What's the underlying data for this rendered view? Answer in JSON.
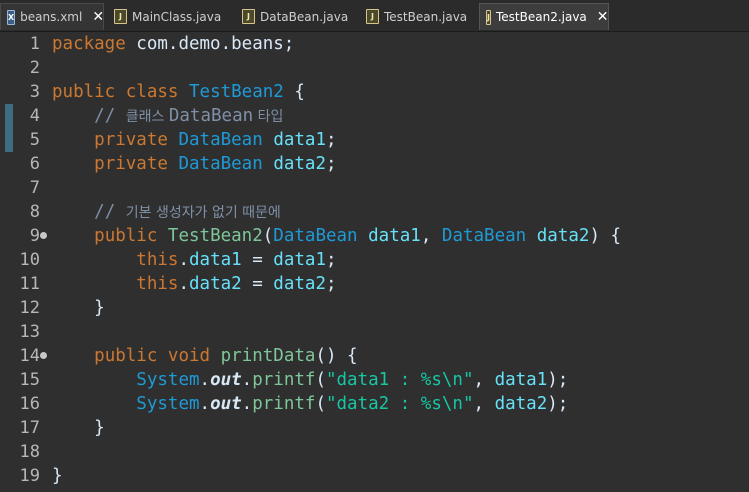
{
  "tabs": [
    {
      "label": "beans.xml",
      "icon": "xml-file-icon",
      "active": false,
      "closable": true
    },
    {
      "label": "MainClass.java",
      "icon": "java-file-icon",
      "active": false,
      "closable": false
    },
    {
      "label": "DataBean.java",
      "icon": "java-file-icon",
      "active": false,
      "closable": false
    },
    {
      "label": "TestBean.java",
      "icon": "java-file-icon",
      "active": false,
      "closable": false
    },
    {
      "label": "TestBean2.java",
      "icon": "java-file-icon",
      "active": true,
      "closable": true
    }
  ],
  "icons": {
    "xml": "X",
    "java": "J",
    "close": "✕",
    "fold": "⊖"
  },
  "lines": [
    {
      "n": "1",
      "tokens": [
        [
          "kw",
          "package"
        ],
        [
          "plain",
          " com.demo.beans;"
        ]
      ]
    },
    {
      "n": "2",
      "tokens": []
    },
    {
      "n": "3",
      "tokens": [
        [
          "kw",
          "public"
        ],
        [
          "plain",
          " "
        ],
        [
          "kw",
          "class"
        ],
        [
          "plain",
          " "
        ],
        [
          "cls",
          "TestBean2"
        ],
        [
          "plain",
          " {"
        ]
      ]
    },
    {
      "n": "4",
      "tokens": [
        [
          "plain",
          "    "
        ],
        [
          "cmt-mono",
          "// "
        ],
        [
          "cmt",
          "클래스 "
        ],
        [
          "cmt-mono",
          "DataBean"
        ],
        [
          "cmt",
          " 타입"
        ]
      ]
    },
    {
      "n": "5",
      "tokens": [
        [
          "plain",
          "    "
        ],
        [
          "kw",
          "private"
        ],
        [
          "plain",
          " "
        ],
        [
          "cls",
          "DataBean"
        ],
        [
          "plain",
          " "
        ],
        [
          "var",
          "data1"
        ],
        [
          "plain",
          ";"
        ]
      ]
    },
    {
      "n": "6",
      "tokens": [
        [
          "plain",
          "    "
        ],
        [
          "kw",
          "private"
        ],
        [
          "plain",
          " "
        ],
        [
          "cls",
          "DataBean"
        ],
        [
          "plain",
          " "
        ],
        [
          "var",
          "data2"
        ],
        [
          "plain",
          ";"
        ]
      ]
    },
    {
      "n": "7",
      "tokens": []
    },
    {
      "n": "8",
      "tokens": [
        [
          "plain",
          "    "
        ],
        [
          "cmt-mono",
          "// "
        ],
        [
          "cmt",
          "기본 생성자가 없기 때문에"
        ]
      ]
    },
    {
      "n": "9",
      "fold": true,
      "tokens": [
        [
          "plain",
          "    "
        ],
        [
          "kw",
          "public"
        ],
        [
          "plain",
          " "
        ],
        [
          "mth",
          "TestBean2"
        ],
        [
          "plain",
          "("
        ],
        [
          "cls",
          "DataBean"
        ],
        [
          "plain",
          " "
        ],
        [
          "var",
          "data1"
        ],
        [
          "plain",
          ", "
        ],
        [
          "cls",
          "DataBean"
        ],
        [
          "plain",
          " "
        ],
        [
          "var",
          "data2"
        ],
        [
          "plain",
          ") {"
        ]
      ]
    },
    {
      "n": "10",
      "tokens": [
        [
          "plain",
          "        "
        ],
        [
          "kw",
          "this"
        ],
        [
          "plain",
          "."
        ],
        [
          "var",
          "data1"
        ],
        [
          "plain",
          " = "
        ],
        [
          "var",
          "data1"
        ],
        [
          "plain",
          ";"
        ]
      ]
    },
    {
      "n": "11",
      "tokens": [
        [
          "plain",
          "        "
        ],
        [
          "kw",
          "this"
        ],
        [
          "plain",
          "."
        ],
        [
          "var",
          "data2"
        ],
        [
          "plain",
          " = "
        ],
        [
          "var",
          "data2"
        ],
        [
          "plain",
          ";"
        ]
      ]
    },
    {
      "n": "12",
      "tokens": [
        [
          "plain",
          "    }"
        ]
      ]
    },
    {
      "n": "13",
      "tokens": []
    },
    {
      "n": "14",
      "fold": true,
      "tokens": [
        [
          "plain",
          "    "
        ],
        [
          "kw",
          "public"
        ],
        [
          "plain",
          " "
        ],
        [
          "kw",
          "void"
        ],
        [
          "plain",
          " "
        ],
        [
          "mth",
          "printData"
        ],
        [
          "plain",
          "() {"
        ]
      ]
    },
    {
      "n": "15",
      "tokens": [
        [
          "plain",
          "        "
        ],
        [
          "sys",
          "System"
        ],
        [
          "plain",
          "."
        ],
        [
          "out",
          "out"
        ],
        [
          "plain",
          "."
        ],
        [
          "mth",
          "printf"
        ],
        [
          "plain",
          "("
        ],
        [
          "str",
          "\"data1 : %s\\n\""
        ],
        [
          "plain",
          ", "
        ],
        [
          "var",
          "data1"
        ],
        [
          "plain",
          ");"
        ]
      ]
    },
    {
      "n": "16",
      "tokens": [
        [
          "plain",
          "        "
        ],
        [
          "sys",
          "System"
        ],
        [
          "plain",
          "."
        ],
        [
          "out",
          "out"
        ],
        [
          "plain",
          "."
        ],
        [
          "mth",
          "printf"
        ],
        [
          "plain",
          "("
        ],
        [
          "str",
          "\"data2 : %s\\n\""
        ],
        [
          "plain",
          ", "
        ],
        [
          "var",
          "data2"
        ],
        [
          "plain",
          ");"
        ]
      ]
    },
    {
      "n": "17",
      "tokens": [
        [
          "plain",
          "    }"
        ]
      ]
    },
    {
      "n": "18",
      "tokens": []
    },
    {
      "n": "19",
      "tokens": [
        [
          "plain",
          "}"
        ]
      ]
    }
  ]
}
